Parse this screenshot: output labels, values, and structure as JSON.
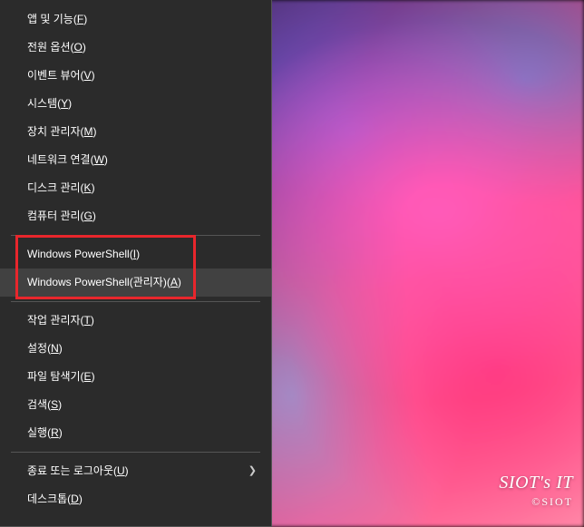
{
  "winx_menu": {
    "items": [
      {
        "id": "apps",
        "label": "앱 및 기능",
        "accel": "F"
      },
      {
        "id": "power",
        "label": "전원 옵션",
        "accel": "O"
      },
      {
        "id": "eventviewer",
        "label": "이벤트 뷰어",
        "accel": "V"
      },
      {
        "id": "system",
        "label": "시스템",
        "accel": "Y"
      },
      {
        "id": "devmgr",
        "label": "장치 관리자",
        "accel": "M"
      },
      {
        "id": "netconn",
        "label": "네트워크 연결",
        "accel": "W"
      },
      {
        "id": "diskmgr",
        "label": "디스크 관리",
        "accel": "K"
      },
      {
        "id": "compmgr",
        "label": "컴퓨터 관리",
        "accel": "G"
      },
      {
        "sep": true
      },
      {
        "id": "ps",
        "label": "Windows PowerShell",
        "accel": "I"
      },
      {
        "id": "psadmin",
        "label": "Windows PowerShell(관리자)",
        "accel": "A",
        "hovered": true
      },
      {
        "sep": true
      },
      {
        "id": "taskmgr",
        "label": "작업 관리자",
        "accel": "T"
      },
      {
        "id": "settings",
        "label": "설정",
        "accel": "N"
      },
      {
        "id": "explorer",
        "label": "파일 탐색기",
        "accel": "E"
      },
      {
        "id": "search",
        "label": "검색",
        "accel": "S"
      },
      {
        "id": "run",
        "label": "실행",
        "accel": "R"
      },
      {
        "sep": true
      },
      {
        "id": "shutdown",
        "label": "종료 또는 로그아웃",
        "accel": "U",
        "submenu": true
      },
      {
        "id": "desktop",
        "label": "데스크톱",
        "accel": "D"
      }
    ]
  },
  "watermark": {
    "line1": "SIOT's IT",
    "line2": "©SIOT"
  },
  "highlight": {
    "targets": [
      "ps",
      "psadmin"
    ]
  }
}
